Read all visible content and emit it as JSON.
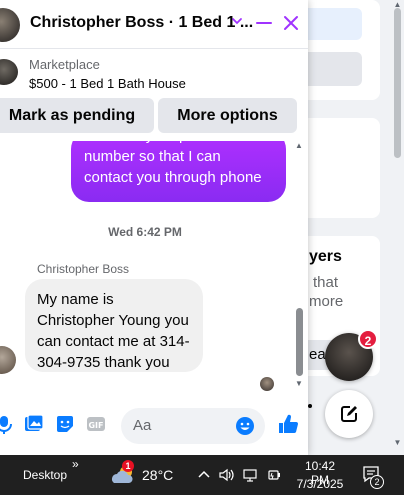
{
  "chat": {
    "title": "Christopher Boss · 1 Bed 1 ...",
    "listing": {
      "label": "Marketplace",
      "title": "$500 - 1 Bed 1 Bath House"
    },
    "actions": {
      "pending": "Mark as pending",
      "more": "More options"
    },
    "outgoing": "send me your phone\nnumber so that I can\ncontact you through phone",
    "timestamp": "Wed 6:42 PM",
    "sender": "Christopher Boss",
    "incoming": "My name is\nChristopher Young you\ncan contact me at 314-\n304-9735 thank you",
    "composer_placeholder": "Aa"
  },
  "background": {
    "heading_fragment": "yers",
    "line1": "that",
    "line2": "more",
    "line3": "ea"
  },
  "floating": {
    "badge": "2"
  },
  "taskbar": {
    "desktop": "Desktop",
    "chevron": "»",
    "weather_badge": "1",
    "temperature": "28°C",
    "time": "10:42 PM",
    "date": "7/3/2025",
    "notification_count": "2"
  },
  "colors": {
    "accent": "#a033ff",
    "messenger_icon": "#0a7cff",
    "header_icons": "#a033ff"
  }
}
